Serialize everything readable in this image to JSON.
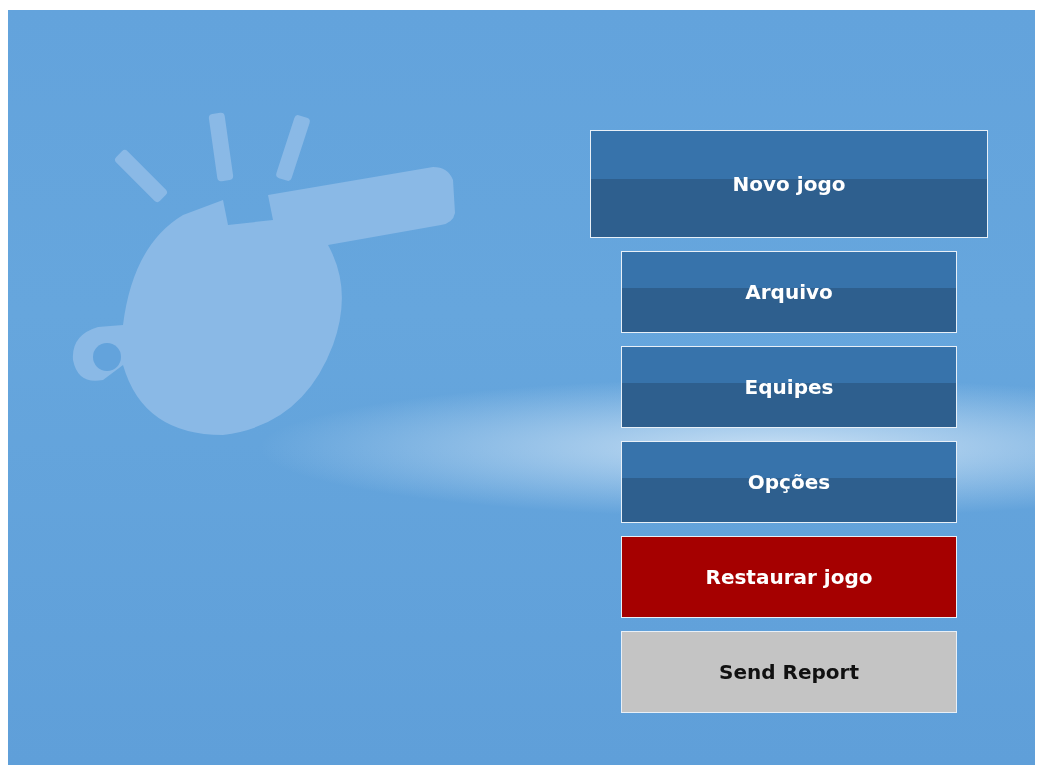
{
  "menu": [
    {
      "label": "Novo jogo",
      "kind": "main"
    },
    {
      "label": "Arquivo",
      "kind": "normal"
    },
    {
      "label": "Equipes",
      "kind": "normal"
    },
    {
      "label": "Opções",
      "kind": "normal"
    },
    {
      "label": "Restaurar jogo",
      "kind": "danger"
    },
    {
      "label": "Send Report",
      "kind": "neutral"
    }
  ]
}
